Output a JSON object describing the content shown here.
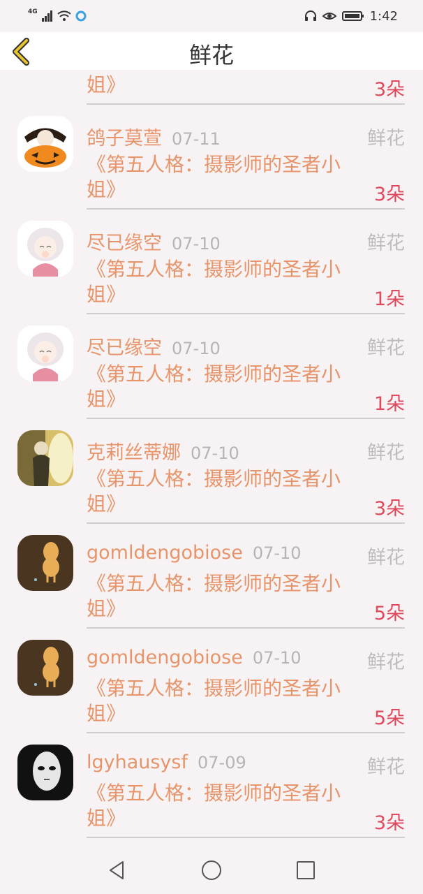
{
  "status_bar": {
    "network": "4G",
    "time": "1:42"
  },
  "header": {
    "title": "鲜花"
  },
  "list": [
    {
      "name": "",
      "date": "",
      "type": "",
      "work": "《第五人格：摄影师的圣者小姐》",
      "count": "3朵"
    },
    {
      "name": "鸽子莫萱",
      "date": "07-11",
      "type": "鲜花",
      "work": "《第五人格：摄影师的圣者小姐》",
      "count": "3朵",
      "avatar": "pumpkin-avatar"
    },
    {
      "name": "尽已缘空",
      "date": "07-10",
      "type": "鲜花",
      "work": "《第五人格：摄影师的圣者小姐》",
      "count": "1朵",
      "avatar": "anime-girl-avatar"
    },
    {
      "name": "尽已缘空",
      "date": "07-10",
      "type": "鲜花",
      "work": "《第五人格：摄影师的圣者小姐》",
      "count": "1朵",
      "avatar": "anime-girl-avatar"
    },
    {
      "name": "克莉丝蒂娜",
      "date": "07-10",
      "type": "鲜花",
      "work": "《第五人格：摄影师的圣者小姐》",
      "count": "3朵",
      "avatar": "painting-avatar"
    },
    {
      "name": "gomldengobiose",
      "date": "07-10",
      "type": "鲜花",
      "work": "《第五人格：摄影师的圣者小姐》",
      "count": "5朵",
      "avatar": "peanut-avatar"
    },
    {
      "name": "gomldengobiose",
      "date": "07-10",
      "type": "鲜花",
      "work": "《第五人格：摄影师的圣者小姐》",
      "count": "5朵",
      "avatar": "peanut-avatar"
    },
    {
      "name": "lgyhausysf",
      "date": "07-09",
      "type": "鲜花",
      "work": "《第五人格：摄影师的圣者小姐》",
      "count": "3朵",
      "avatar": "mask-avatar"
    }
  ],
  "colors": {
    "name": "#e8946a",
    "count": "#e0495b",
    "muted": "#bdbdbd",
    "back_arrow": "#e8c530"
  }
}
